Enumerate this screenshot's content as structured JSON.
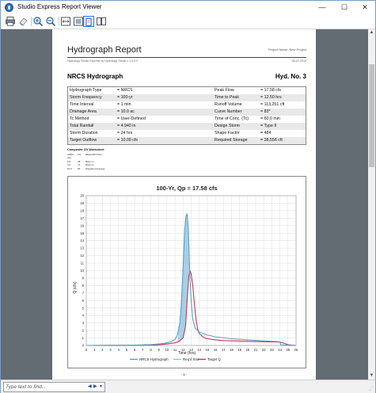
{
  "window": {
    "title": "Studio Express Report Viewer",
    "controls": {
      "minimize": "—",
      "maximize": "☐",
      "close": "✕"
    }
  },
  "toolbar": {
    "icons": [
      "print-icon",
      "clear-icon",
      "zoom-in-icon",
      "zoom-out-icon",
      "fit-width-icon",
      "fit-page-icon",
      "page-icon",
      "multi-page-icon"
    ]
  },
  "report": {
    "title": "Hydrograph Report",
    "project": "Project Name: New Project",
    "subtitle": "Hydrology Studio Express by Hydrology Studio v 1.0.0.0",
    "date": "05-22-2018",
    "section_title": "NRCS Hydrograph",
    "hyd_no": "Hyd. No. 3",
    "params": [
      {
        "l1": "Hydrograph Type",
        "v1": "= NRCS",
        "l2": "Peak Flow",
        "v2": "= 17.58 cfs"
      },
      {
        "l1": "Storm Frequency",
        "v1": "= 100-yr",
        "l2": "Time to Peak",
        "v2": "= 12.50 hrs"
      },
      {
        "l1": "Time Interval",
        "v1": "= 1 min",
        "l2": "Runoff Volume",
        "v2": "= 113,251 cft"
      },
      {
        "l1": "Drainage Area",
        "v1": "= 10.0 ac",
        "l2": "Curve Number",
        "v2": "= 83*"
      },
      {
        "l1": "Tc Method",
        "v1": "= User-Defined",
        "l2": "Time of Conc. (Tc)",
        "v2": "= 60.0 min"
      },
      {
        "l1": "Total Rainfall",
        "v1": "= 4.940 in",
        "l2": "Design Storm",
        "v2": "= Type II"
      },
      {
        "l1": "Storm Duration",
        "v1": "= 24 hrs",
        "l2": "Shape Factor",
        "v2": "= 484"
      },
      {
        "l1": "Target Outflow",
        "v1": "= 10.00 cfs",
        "l2": "Required Storage",
        "v2": "= 38,556 cft"
      }
    ],
    "worksheet": {
      "title": "Composite CN Worksheet",
      "headers": [
        "AREA (ac)",
        "CN",
        "DESCRIPTION"
      ],
      "rows": [
        [
          "6.0",
          "98",
          "Basin 1"
        ],
        [
          "4.0",
          "74",
          "Basin 2"
        ],
        [
          "10.0",
          "83",
          "Weighted Average"
        ]
      ]
    },
    "page_number": "- 1 -"
  },
  "colors": {
    "hydrograph": "#5a9fc8",
    "storage_fill": "#8cc0e0",
    "target": "#c8365a",
    "window_border": "#7a9cc4",
    "viewer_bg": "#636b73"
  },
  "chart_data": {
    "type": "line",
    "title": "100-Yr, Qp = 17.58 cfs",
    "xlabel": "Time (hrs)",
    "ylabel": "Q (cfs)",
    "xlim": [
      0,
      26
    ],
    "ylim": [
      0,
      20
    ],
    "xticks": [
      0,
      1,
      2,
      3,
      4,
      5,
      6,
      7,
      8,
      9,
      10,
      11,
      12,
      13,
      14,
      15,
      16,
      17,
      18,
      19,
      20,
      21,
      22,
      23,
      24,
      25,
      26
    ],
    "yticks": [
      0,
      1,
      2,
      3,
      4,
      5,
      6,
      7,
      8,
      9,
      10,
      11,
      12,
      13,
      14,
      15,
      16,
      17,
      18,
      19,
      20
    ],
    "grid": true,
    "legend_position": "bottom",
    "legend": [
      "NRCS Hydrograph",
      "Req'd Stor",
      "Target Q"
    ],
    "series": [
      {
        "name": "NRCS Hydrograph",
        "x": [
          0,
          6,
          8,
          9,
          10,
          10.5,
          11,
          11.3,
          11.6,
          11.8,
          12.0,
          12.2,
          12.35,
          12.5,
          12.65,
          12.8,
          13.0,
          13.2,
          13.5,
          14,
          15,
          16,
          18,
          20,
          22,
          24,
          24.1,
          25,
          26
        ],
        "y": [
          0,
          0.05,
          0.12,
          0.2,
          0.35,
          0.5,
          0.8,
          1.4,
          3.0,
          6.0,
          10.5,
          15.5,
          17.3,
          17.58,
          15.5,
          10.5,
          6.0,
          3.5,
          2.3,
          1.8,
          1.4,
          1.15,
          0.9,
          0.75,
          0.62,
          0.5,
          0.1,
          0.02,
          0
        ]
      },
      {
        "name": "Target Q",
        "x": [
          0,
          6,
          8,
          9,
          10,
          11,
          11.5,
          12.0,
          12.3,
          12.5,
          12.7,
          12.85,
          13.0,
          13.2,
          13.4,
          13.6,
          13.8,
          14.0,
          14.5,
          15,
          16,
          17,
          20,
          22,
          24,
          24.5,
          25,
          26
        ],
        "y": [
          0,
          0.02,
          0.05,
          0.1,
          0.2,
          0.35,
          0.55,
          1.0,
          2.5,
          6.0,
          9.2,
          10.0,
          9.6,
          8.0,
          5.5,
          3.5,
          2.2,
          1.6,
          1.1,
          0.9,
          0.75,
          0.65,
          0.55,
          0.5,
          0.45,
          0.3,
          0.1,
          0
        ]
      }
    ]
  },
  "findbar": {
    "placeholder": "Type text to find...",
    "prev": "◀",
    "next": "▶",
    "dropdown": "▾"
  }
}
